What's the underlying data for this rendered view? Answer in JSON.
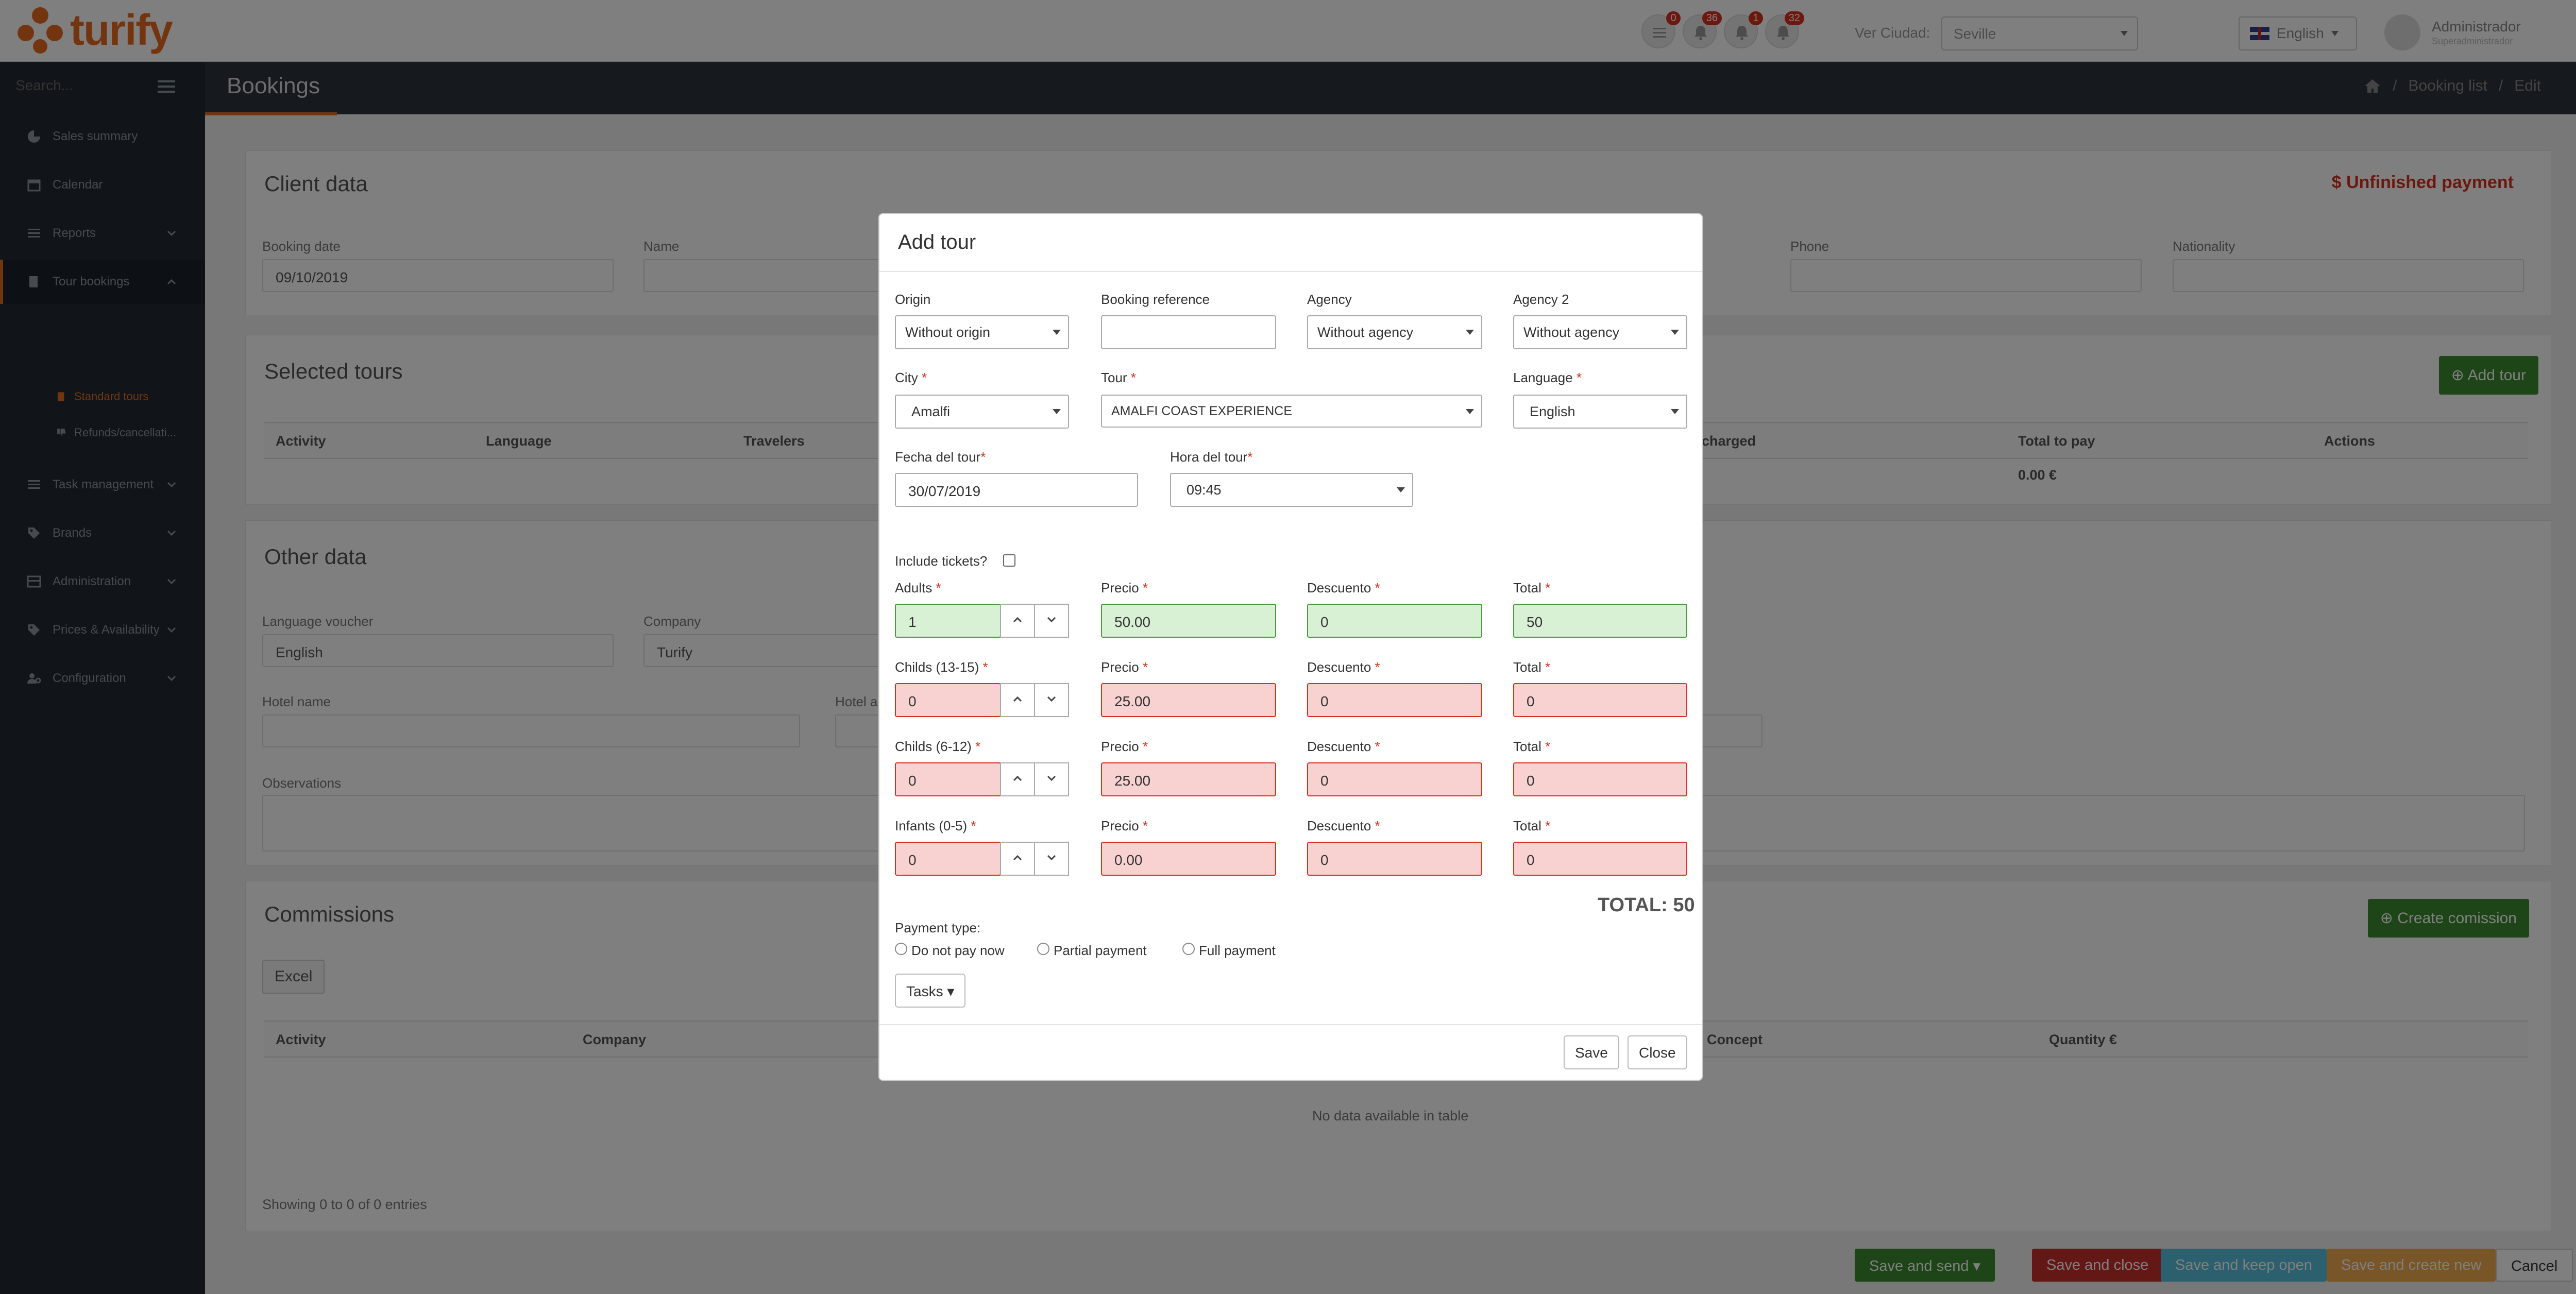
{
  "topbar": {
    "logo_text": "turify",
    "notifications": [
      {
        "icon": "list-icon",
        "count": "0"
      },
      {
        "icon": "bell-icon",
        "count": "36"
      },
      {
        "icon": "bell-icon",
        "count": "1"
      },
      {
        "icon": "bell-icon",
        "count": "32"
      }
    ],
    "city_label": "Ver Ciudad:",
    "city_value": "Seville",
    "language": "English",
    "user_name": "Administrador",
    "user_role": "Superadministrador"
  },
  "sidebar": {
    "search_placeholder": "Search...",
    "items": [
      {
        "label": "Sales summary",
        "icon": "pie-chart-icon"
      },
      {
        "label": "Calendar",
        "icon": "calendar-icon"
      },
      {
        "label": "Reports",
        "icon": "list-icon"
      },
      {
        "label": "Tour bookings",
        "icon": "book-icon"
      },
      {
        "label": "Task management",
        "icon": "tasks-icon"
      },
      {
        "label": "Brands",
        "icon": "tags-icon"
      },
      {
        "label": "Administration",
        "icon": "table-icon"
      },
      {
        "label": "Prices & Availability",
        "icon": "tags-icon"
      },
      {
        "label": "Configuration",
        "icon": "users-cog-icon"
      }
    ],
    "sub_items": [
      {
        "label": "Standard tours"
      },
      {
        "label": "Refunds/cancellati..."
      }
    ]
  },
  "header": {
    "title": "Bookings",
    "breadcrumb": [
      "Booking list",
      "Edit"
    ]
  },
  "client_data": {
    "title": "Client data",
    "payment_status": "$ Unfinished payment",
    "booking_date_label": "Booking date",
    "booking_date": "09/10/2019",
    "name_label": "Name",
    "phone_label": "Phone",
    "nationality_label": "Nationality"
  },
  "selected_tours": {
    "title": "Selected tours",
    "add_button": "Add tour",
    "columns": [
      "Activity",
      "Language",
      "Travelers",
      "charged",
      "Total to pay",
      "Actions"
    ],
    "total_value": "0.00 €"
  },
  "other_data": {
    "title": "Other data",
    "language_voucher_label": "Language voucher",
    "language_voucher": "English",
    "company_label": "Company",
    "company": "Turify",
    "hotel_name_label": "Hotel name",
    "hotel_a_label": "Hotel a",
    "observations_label": "Observations"
  },
  "commissions": {
    "title": "Commissions",
    "create_button": "Create comission",
    "excel_button": "Excel",
    "columns": [
      "Activity",
      "Company",
      "Concept",
      "Quantity €"
    ],
    "empty_text": "No data available in table",
    "showing_text": "Showing 0 to 0 of 0 entries"
  },
  "footer_buttons": {
    "save_send": "Save and send",
    "save_close": "Save and close",
    "save_keep": "Save and keep open",
    "save_new": "Save and create new",
    "cancel": "Cancel"
  },
  "modal": {
    "title": "Add tour",
    "origin_label": "Origin",
    "origin_value": "Without origin",
    "booking_ref_label": "Booking reference",
    "booking_ref_value": "",
    "agency_label": "Agency",
    "agency_value": "Without agency",
    "agency2_label": "Agency 2",
    "agency2_value": "Without agency",
    "city_label": "City",
    "city_value": "Amalfi",
    "tour_label": "Tour",
    "tour_value": "AMALFI COAST EXPERIENCE",
    "language_label": "Language",
    "language_value": "English",
    "fecha_label": "Fecha del tour",
    "fecha_value": "30/07/2019",
    "hora_label": "Hora del tour",
    "hora_value": "09:45",
    "tickets_label": "Include tickets?",
    "price_rows": [
      {
        "label": "Adults",
        "qty": "1",
        "price": "50.00",
        "discount": "0",
        "total": "50",
        "state": "ok"
      },
      {
        "label": "Childs (13-15)",
        "qty": "0",
        "price": "25.00",
        "discount": "0",
        "total": "0",
        "state": "err"
      },
      {
        "label": "Childs (6-12)",
        "qty": "0",
        "price": "25.00",
        "discount": "0",
        "total": "0",
        "state": "err"
      },
      {
        "label": "Infants (0-5)",
        "qty": "0",
        "price": "0.00",
        "discount": "0",
        "total": "0",
        "state": "err"
      }
    ],
    "precio_label": "Precio",
    "descuento_label": "Descuento",
    "total_label": "Total",
    "total_text": "TOTAL: 50",
    "payment_type_label": "Payment type:",
    "payment_options": [
      "Do not pay now",
      "Partial payment",
      "Full payment"
    ],
    "tasks_button": "Tasks",
    "save_button": "Save",
    "close_button": "Close"
  },
  "colors": {
    "brand": "#e66b1f",
    "ok_bg": "#d8f0d4",
    "ok_border": "#4a9a3e",
    "err_bg": "#f8d1d1",
    "err_border": "#d9311f",
    "green_button": "#3a8a2e",
    "red_button": "#c9302c",
    "blue_button": "#5bc0de",
    "orange_button": "#f0ad4e"
  }
}
